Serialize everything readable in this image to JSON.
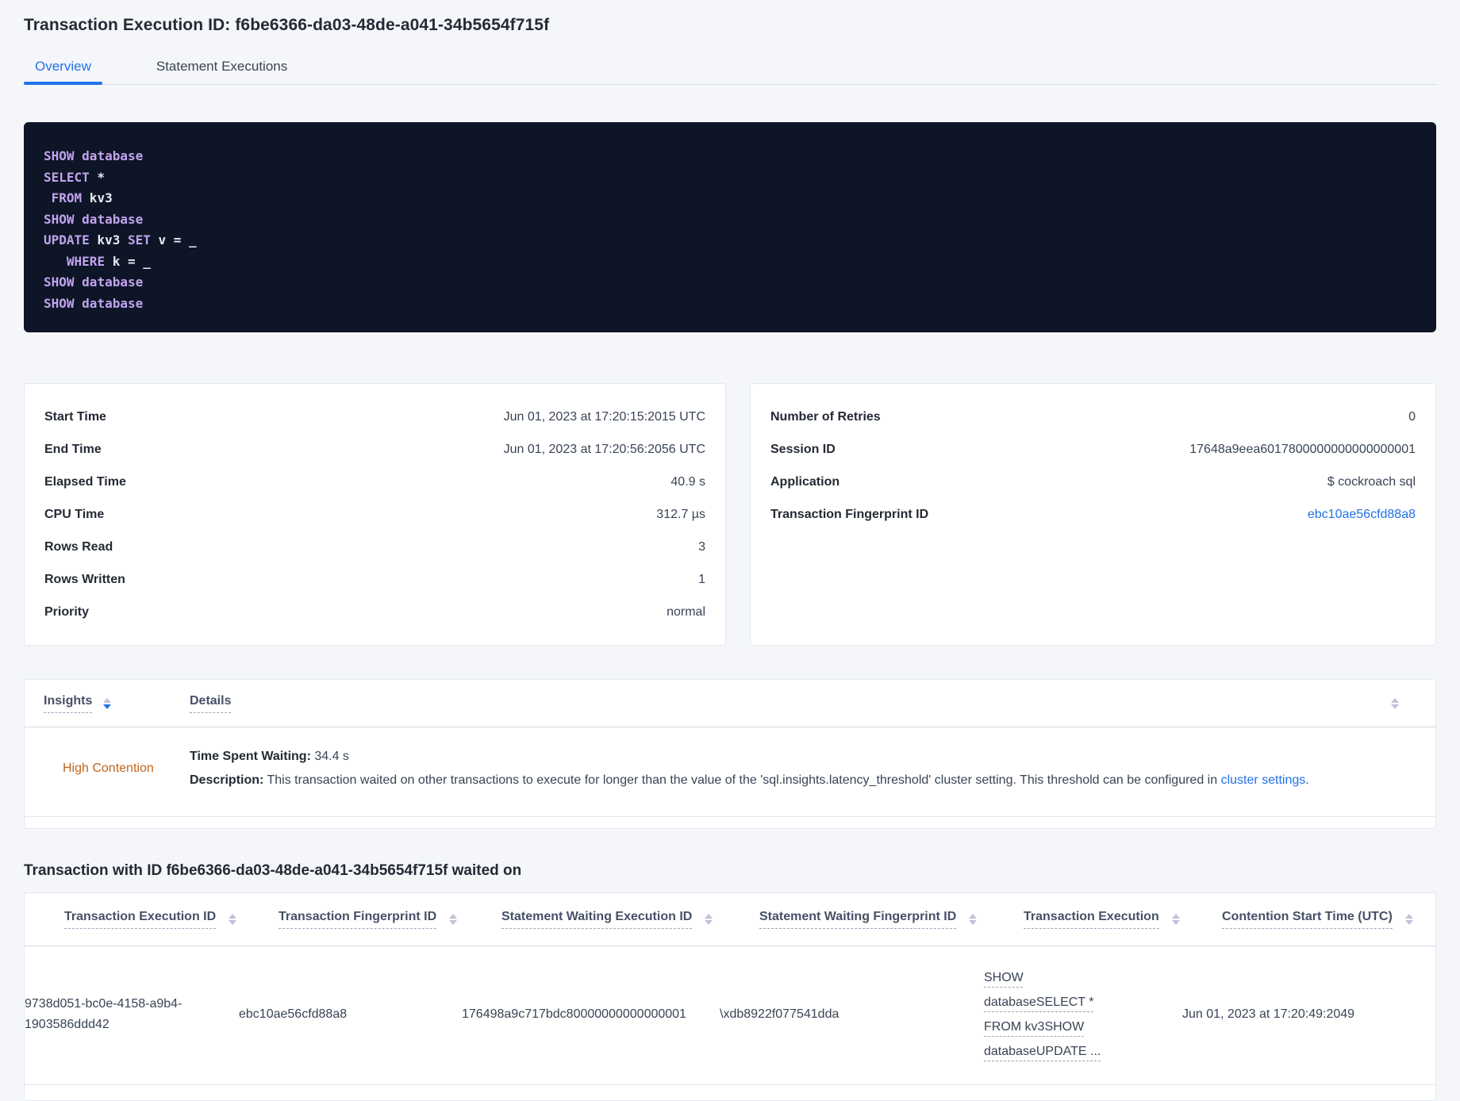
{
  "header": {
    "title": "Transaction Execution ID: f6be6366-da03-48de-a041-34b5654f715f",
    "tabs": [
      {
        "label": "Overview",
        "active": true
      },
      {
        "label": "Statement Executions",
        "active": false
      }
    ]
  },
  "sql": {
    "lines": [
      {
        "segments": [
          {
            "text": "SHOW",
            "kw": true
          },
          {
            "text": " "
          },
          {
            "text": "database",
            "kw": true
          }
        ]
      },
      {
        "segments": [
          {
            "text": "SELECT",
            "kw": true
          },
          {
            "text": " *"
          }
        ]
      },
      {
        "segments": [
          {
            "text": " "
          },
          {
            "text": "FROM",
            "kw": true
          },
          {
            "text": " kv3"
          }
        ]
      },
      {
        "segments": [
          {
            "text": "SHOW",
            "kw": true
          },
          {
            "text": " "
          },
          {
            "text": "database",
            "kw": true
          }
        ]
      },
      {
        "segments": [
          {
            "text": "UPDATE",
            "kw": true
          },
          {
            "text": " kv3 "
          },
          {
            "text": "SET",
            "kw": true
          },
          {
            "text": " v = _"
          }
        ]
      },
      {
        "segments": [
          {
            "text": "   "
          },
          {
            "text": "WHERE",
            "kw": true
          },
          {
            "text": " k = _"
          }
        ]
      },
      {
        "segments": [
          {
            "text": "SHOW",
            "kw": true
          },
          {
            "text": " "
          },
          {
            "text": "database",
            "kw": true
          }
        ]
      },
      {
        "segments": [
          {
            "text": "SHOW",
            "kw": true
          },
          {
            "text": " "
          },
          {
            "text": "database",
            "kw": true
          }
        ]
      }
    ]
  },
  "left_card": {
    "rows": [
      {
        "label": "Start Time",
        "value": "Jun 01, 2023 at 17:20:15:2015 UTC"
      },
      {
        "label": "End Time",
        "value": "Jun 01, 2023 at 17:20:56:2056 UTC"
      },
      {
        "label": "Elapsed Time",
        "value": "40.9 s"
      },
      {
        "label": "CPU Time",
        "value": "312.7 µs"
      },
      {
        "label": "Rows Read",
        "value": "3"
      },
      {
        "label": "Rows Written",
        "value": "1"
      },
      {
        "label": "Priority",
        "value": "normal"
      }
    ]
  },
  "right_card": {
    "rows": [
      {
        "label": "Number of Retries",
        "value": "0"
      },
      {
        "label": "Session ID",
        "value": "17648a9eea6017800000000000000001"
      },
      {
        "label": "Application",
        "value": "$ cockroach sql"
      },
      {
        "label": "Transaction Fingerprint ID",
        "value": "ebc10ae56cfd88a8",
        "link": true
      }
    ]
  },
  "insights": {
    "columns": {
      "insights": "Insights",
      "details": "Details"
    },
    "row": {
      "insight": "High Contention",
      "waiting_label": "Time Spent Waiting:",
      "waiting_value": " 34.4 s",
      "description_label": "Description:",
      "description_text": " This transaction waited on other transactions to execute for longer than the value of the 'sql.insights.latency_threshold' cluster setting. This threshold can be configured in ",
      "description_link": "cluster settings",
      "description_suffix": "."
    }
  },
  "waited_on": {
    "heading": "Transaction with ID f6be6366-da03-48de-a041-34b5654f715f waited on",
    "columns": [
      "Transaction Execution ID",
      "Transaction Fingerprint ID",
      "Statement Waiting Execution ID",
      "Statement Waiting Fingerprint ID",
      "Transaction Execution",
      "Contention Start Time (UTC)"
    ],
    "row": {
      "execution_id": "9738d051-bc0e-4158-a9b4-1903586ddd42",
      "fingerprint_id": "ebc10ae56cfd88a8",
      "stmt_waiting_execution_id": "176498a9c717bdc80000000000000001",
      "stmt_waiting_fingerprint_id": "\\xdb8922f077541dda",
      "transaction_execution": "SHOW databaseSELECT * FROM kv3SHOW databaseUPDATE ...",
      "contention_start": "Jun 01, 2023 at 17:20:49:2049"
    }
  }
}
